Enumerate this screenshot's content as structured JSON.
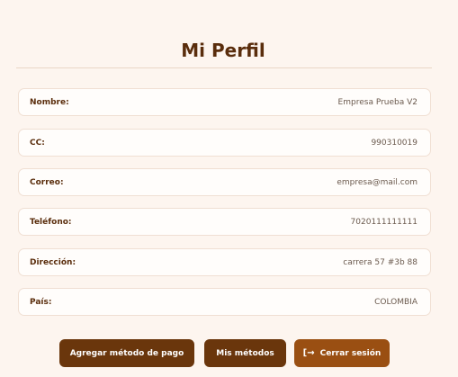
{
  "profile": {
    "title": "Mi Perfil",
    "fields": [
      {
        "label": "Nombre:",
        "value": "Empresa Prueba V2"
      },
      {
        "label": "CC:",
        "value": "990310019"
      },
      {
        "label": "Correo:",
        "value": "empresa@mail.com"
      },
      {
        "label": "Teléfono:",
        "value": "7020111111111"
      },
      {
        "label": "Dirección:",
        "value": "carrera 57 #3b 88"
      },
      {
        "label": "País:",
        "value": "COLOMBIA"
      }
    ]
  },
  "actions": {
    "add_payment_label": "Agregar método de pago",
    "my_methods_label": "Mis métodos",
    "logout_label": "Cerrar sesión"
  },
  "colors": {
    "background": "#fdf5ef",
    "title": "#5a2d0c",
    "button_dark": "#6a360c",
    "button_accent": "#9a4f12"
  }
}
